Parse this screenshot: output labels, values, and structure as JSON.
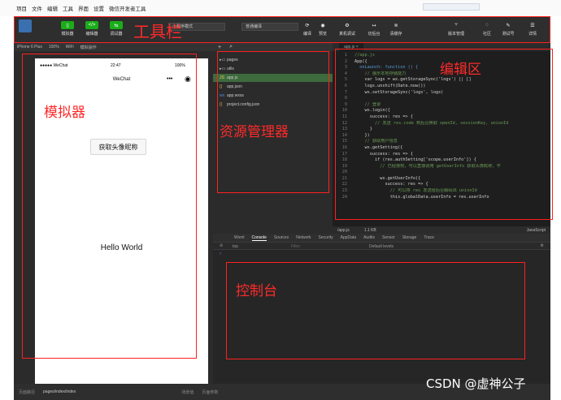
{
  "menubar": [
    "项目",
    "文件",
    "编辑",
    "工具",
    "界面",
    "设置",
    "微信开发者工具"
  ],
  "toolbar": {
    "btn_sim": "模拟器",
    "btn_editor": "编辑器",
    "btn_debug": "调试器",
    "mode": "小程序模式",
    "compile": "普通编译",
    "btn_compile": "编译",
    "btn_preview": "预览",
    "btn_realdebug": "真机调试",
    "btn_bg": "切后台",
    "btn_cache": "清缓存",
    "btn_version": "版本管理",
    "btn_community": "社区",
    "btn_testid": "测试号",
    "btn_detail": "详情"
  },
  "annotations": {
    "toolbar": "工具栏",
    "simulator": "模拟器",
    "explorer": "资源管理器",
    "editor": "编辑区",
    "console": "控制台"
  },
  "simbar": {
    "device": "iPhone 6 Plus",
    "zoom": "100%",
    "net": "WiFi",
    "op": "模拟操作"
  },
  "phone": {
    "carrier": "●●●●● WeChat",
    "time": "22:47",
    "battery": "100%",
    "title": "WeChat",
    "button": "获取头像昵称",
    "hello": "Hello World"
  },
  "files": [
    {
      "name": "pages",
      "icon": "folder"
    },
    {
      "name": "utils",
      "icon": "folder"
    },
    {
      "name": "app.js",
      "icon": "js"
    },
    {
      "name": "app.json",
      "icon": "json"
    },
    {
      "name": "app.wxss",
      "icon": "wxss"
    },
    {
      "name": "project.config.json",
      "icon": "json"
    }
  ],
  "editor": {
    "tab": "app.js",
    "lines": [
      [
        "1",
        "//app.js",
        "c"
      ],
      [
        "2",
        "App({",
        "t"
      ],
      [
        "3",
        "  onLaunch: function () {",
        "k"
      ],
      [
        "4",
        "    // 展示本地存储能力",
        "c"
      ],
      [
        "5",
        "    var logs = wx.getStorageSync('logs') || []",
        "t"
      ],
      [
        "6",
        "    logs.unshift(Date.now())",
        "t"
      ],
      [
        "7",
        "    wx.setStorageSync('logs', logs)",
        "t"
      ],
      [
        "8",
        "",
        "t"
      ],
      [
        "9",
        "    // 登录",
        "c"
      ],
      [
        "10",
        "    wx.login({",
        "t"
      ],
      [
        "11",
        "      success: res => {",
        "t"
      ],
      [
        "12",
        "        // 发送 res.code 到后台换取 openId, sessionKey, unionId",
        "c"
      ],
      [
        "13",
        "      }",
        "t"
      ],
      [
        "14",
        "    })",
        "t"
      ],
      [
        "15",
        "    // 获取用户信息",
        "c"
      ],
      [
        "16",
        "    wx.getSetting({",
        "t"
      ],
      [
        "17",
        "      success: res => {",
        "t"
      ],
      [
        "18",
        "        if (res.authSetting['scope.userInfo']) {",
        "t"
      ],
      [
        "19",
        "          // 已经授权，可以直接调用 getUserInfo 获取头像昵称，不",
        "c"
      ],
      [
        "20",
        "",
        "t"
      ],
      [
        "21",
        "          wx.getUserInfo({",
        "t"
      ],
      [
        "22",
        "            success: res => {",
        "t"
      ],
      [
        "23",
        "              // 可以将 res 发送给后台解码出 unionId",
        "c"
      ],
      [
        "24",
        "              this.globalData.userInfo = res.userInfo",
        "t"
      ]
    ],
    "status_file": "/app.js",
    "status_size": "1.1 KB",
    "status_lang": "JavaScript"
  },
  "console": {
    "tabs": [
      "Wxml",
      "Console",
      "Sources",
      "Network",
      "Security",
      "AppData",
      "Audits",
      "Sensor",
      "Storage",
      "Trace"
    ],
    "context": "top",
    "filter": "Filter",
    "levels": "Default levels"
  },
  "bottom": {
    "label": "页面路径",
    "path": "pages/index/index",
    "right1": "场景值",
    "right2": "页面参数"
  },
  "watermark": "CSDN @虚神公子"
}
